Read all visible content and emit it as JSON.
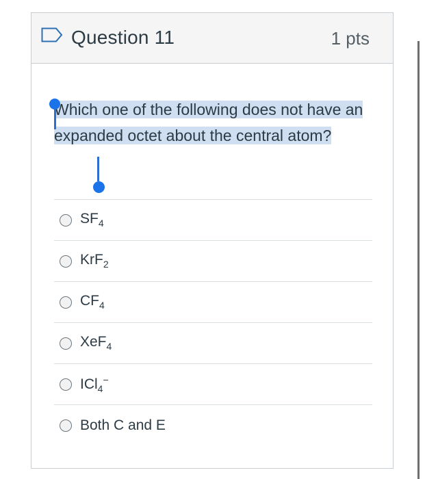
{
  "question": {
    "title": "Question 11",
    "points": "1 pts",
    "text": "Which one of the following does not have an expanded octet about the central atom?"
  },
  "answers": [
    {
      "base": "SF",
      "sub": "4",
      "sup": ""
    },
    {
      "base": "KrF",
      "sub": "2",
      "sup": ""
    },
    {
      "base": "CF",
      "sub": "4",
      "sup": ""
    },
    {
      "base": "XeF",
      "sub": "4",
      "sup": ""
    },
    {
      "base": "ICl",
      "sub": "4",
      "sup": "−"
    },
    {
      "base": "Both C and E",
      "sub": "",
      "sup": ""
    }
  ],
  "colors": {
    "selection": "#cfdef0",
    "handle": "#1a73e8",
    "header_bg": "#f5f5f5",
    "border": "#c7cdd1"
  },
  "icons": {
    "flag": "bookmark-flag-icon",
    "radio": "radio-unselected"
  }
}
